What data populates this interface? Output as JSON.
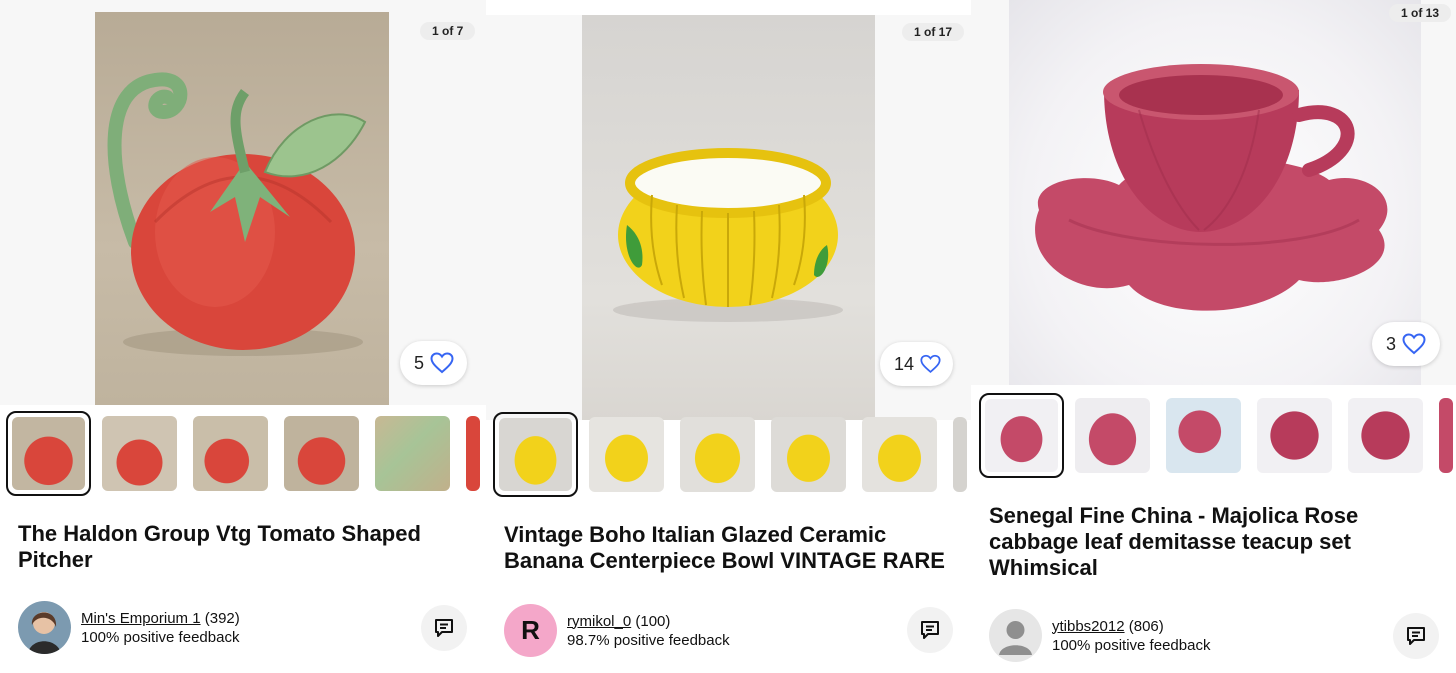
{
  "listings": [
    {
      "image_counter": "1 of 7",
      "likes": "5",
      "title": "The Haldon Group Vtg Tomato Shaped Pitcher",
      "seller": {
        "name": "Min's Emporium 1",
        "count": "(392)",
        "feedback": "100% positive feedback"
      },
      "thumbnails": 6
    },
    {
      "image_counter": "1 of 17",
      "likes": "14",
      "title": "Vintage Boho Italian Glazed Ceramic Banana Centerpiece Bowl VINTAGE RARE",
      "seller": {
        "name": "rymikol_0",
        "count": "(100)",
        "feedback": "98.7% positive feedback",
        "avatar_letter": "R"
      },
      "thumbnails": 6
    },
    {
      "image_counter": "1 of 13",
      "likes": "3",
      "title": "Senegal Fine China - Majolica Rose cabbage leaf demitasse teacup set Whimsical",
      "seller": {
        "name": "ytibbs2012",
        "count": "(806)",
        "feedback": "100% positive feedback"
      },
      "thumbnails": 6
    }
  ],
  "icons": {
    "like": "heart-outline-icon",
    "message": "message-icon",
    "placeholder_avatar": "person-icon"
  },
  "colors": {
    "heart": "#3665f3",
    "avatar_r_bg": "#f4a7c9"
  }
}
